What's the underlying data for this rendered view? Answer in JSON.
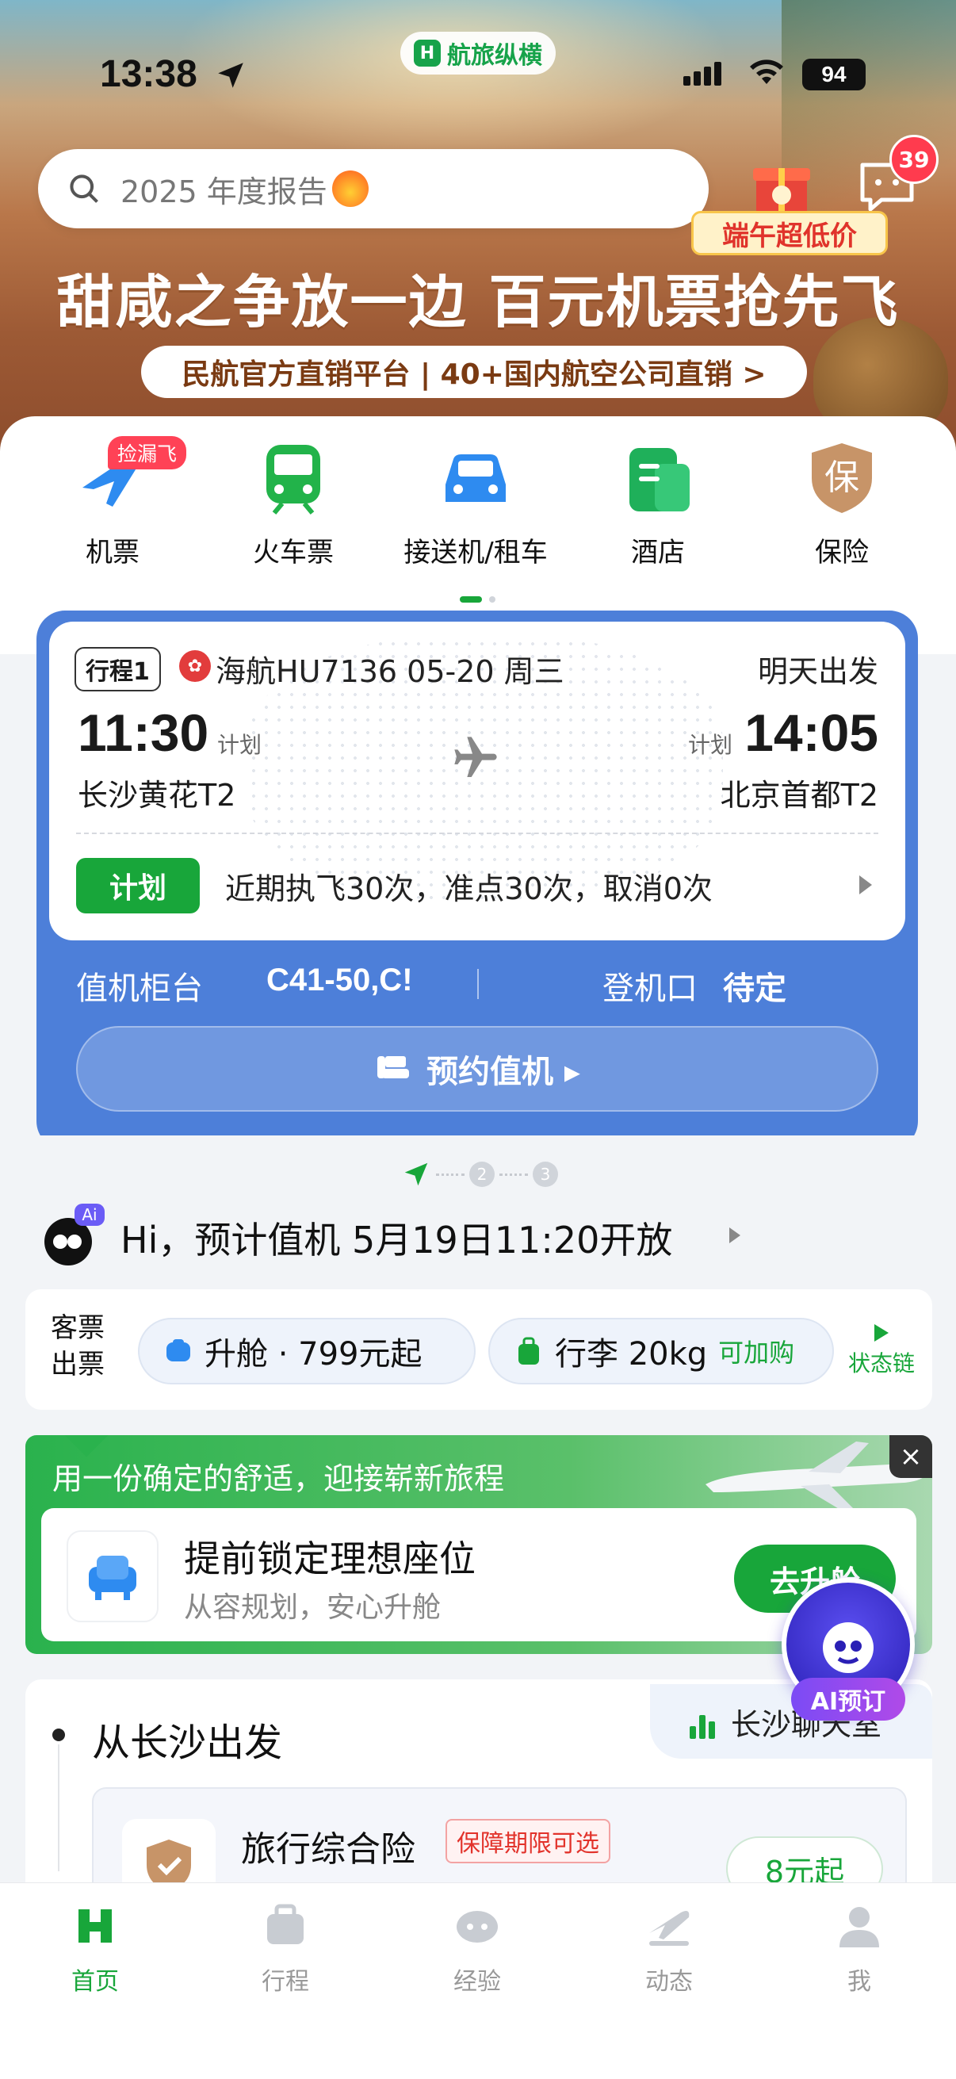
{
  "status_bar": {
    "time": "13:38",
    "app_name": "航旅纵横",
    "battery": "94"
  },
  "header": {
    "search_placeholder": "2025 年度报告",
    "message_badge": "39",
    "promo_tag": "端午超低价",
    "headline": "甜咸之争放一边 百元机票抢先飞",
    "subline": "民航官方直销平台 | 40+国内航空公司直销 >"
  },
  "categories": [
    {
      "label": "机票",
      "icon": "plane-icon",
      "badge": "捡漏飞"
    },
    {
      "label": "火车票",
      "icon": "train-icon"
    },
    {
      "label": "接送机/租车",
      "icon": "car-icon"
    },
    {
      "label": "酒店",
      "icon": "hotel-icon"
    },
    {
      "label": "保险",
      "icon": "insurance-icon",
      "icon_text": "保"
    }
  ],
  "flight": {
    "trip_tag": "行程1",
    "airline_info": "海航HU7136 05-20 周三",
    "depart_when": "明天出发",
    "dep_time": "11:30",
    "dep_plan": "计划",
    "dep_city": "长沙黄花T2",
    "arr_plan": "计划",
    "arr_time": "14:05",
    "arr_city": "北京首都T2",
    "status_pill": "计划",
    "stats": "近期执飞30次，准点30次，取消0次",
    "counter_label": "值机柜台",
    "counter_value": "C41-50,C!",
    "gate_label": "登机口",
    "gate_value": "待定",
    "checkin_button": "预约值机 ▸"
  },
  "steps": [
    "2",
    "3"
  ],
  "ai_message": "Hi，预计值机 5月19日11:20开放",
  "ai_avatar_badge": "Ai",
  "ticket": {
    "status": "客票\n出票",
    "status_line1": "客票",
    "status_line2": "出票",
    "upgrade_chip": "升舱 · 799元起",
    "luggage_chip": "行李 20kg",
    "luggage_extra": "可加购",
    "chain_label": "状态链"
  },
  "upgrade": {
    "title": "用一份确定的舒适，迎接崭新旅程",
    "main": "提前锁定理想座位",
    "sub": "从容规划，安心升舱",
    "button": "去升舱",
    "close": "×"
  },
  "ai_fab_label": "AI预订",
  "depart": {
    "title": "从长沙出发",
    "weather_tab": "长沙聊天室",
    "insurance_title": "旅行综合险",
    "insurance_tag": "保障期限可选",
    "insurance_price": "8元起"
  },
  "tabbar": [
    {
      "label": "首页",
      "icon": "home-icon",
      "active": true
    },
    {
      "label": "行程",
      "icon": "trip-icon"
    },
    {
      "label": "经验",
      "icon": "experience-icon"
    },
    {
      "label": "动态",
      "icon": "flight-status-icon"
    },
    {
      "label": "我",
      "icon": "profile-icon"
    }
  ],
  "colors": {
    "brand_green": "#18a63a",
    "flight_blue": "#4d7fd9",
    "badge_red": "#ff3b4e"
  }
}
